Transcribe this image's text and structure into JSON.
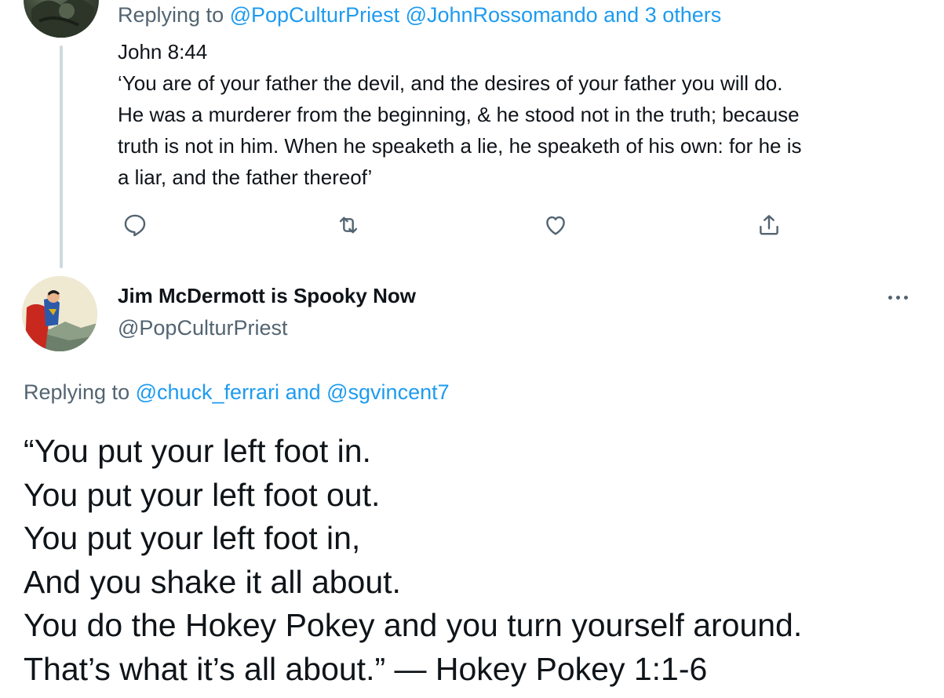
{
  "previous_tweet": {
    "replying_prefix": "Replying to ",
    "replying_mentions": "@PopCulturPriest @JohnRossomando",
    "replying_and_others": " and 3 others",
    "lines": [
      "John 8:44",
      "‘You are of your father the devil, and the desires of your father you will do.",
      "He was a murderer from the beginning, & he stood not in the truth; because",
      "truth is not in him. When he speaketh a lie, he speaketh of his own: for he is",
      "a liar, and the father thereof’"
    ],
    "actions": [
      {
        "name": "reply",
        "icon": "reply-icon"
      },
      {
        "name": "retweet",
        "icon": "retweet-icon"
      },
      {
        "name": "like",
        "icon": "heart-icon"
      },
      {
        "name": "share",
        "icon": "share-icon"
      }
    ]
  },
  "main_tweet": {
    "display_name": "Jim McDermott is Spooky Now",
    "handle": "@PopCulturPriest",
    "more_icon": "more-icon",
    "replying_prefix": "Replying to ",
    "replying_user1": "@chuck_ferrari",
    "replying_and": " and ",
    "replying_user2": "@sgvincent7",
    "lines": [
      "“You put your left foot in.",
      "You put your left foot out.",
      "You put your left foot in,",
      "And you shake it all about.",
      "You do the Hokey Pokey and you turn yourself around.",
      "That’s what it’s all about.” — Hokey Pokey 1:1-6"
    ]
  },
  "colors": {
    "link": "#1d9bf0",
    "secondary_text": "#536471",
    "primary_text": "#0f1419",
    "thread_line": "#cfd9de"
  }
}
